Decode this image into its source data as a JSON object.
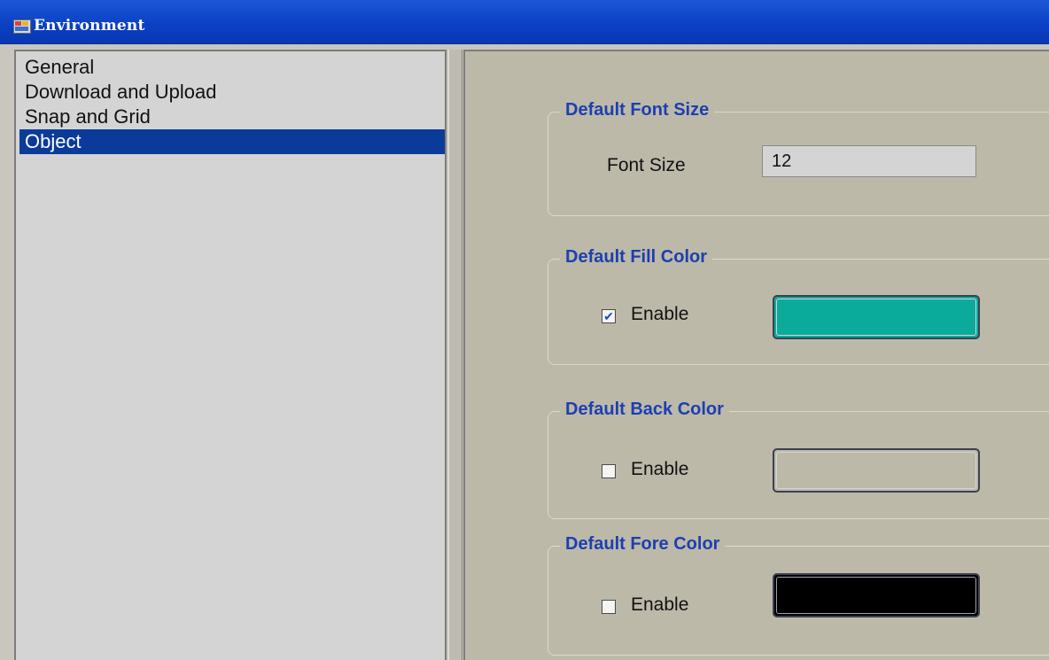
{
  "window": {
    "title": "Environment"
  },
  "tree": {
    "items": [
      {
        "label": "General"
      },
      {
        "label": "Download and Upload"
      },
      {
        "label": "Snap and Grid"
      },
      {
        "label": "Object",
        "selected": true
      }
    ]
  },
  "groups": {
    "font_size": {
      "title": "Default Font Size",
      "label": "Font Size",
      "value": "12"
    },
    "fill_color": {
      "title": "Default Fill Color",
      "enable_label": "Enable",
      "enabled": true,
      "color": "#0aab9a"
    },
    "back_color": {
      "title": "Default Back Color",
      "enable_label": "Enable",
      "enabled": false,
      "color": "#bcb9a9"
    },
    "fore_color": {
      "title": "Default Fore Color",
      "enable_label": "Enable",
      "enabled": false,
      "color": "#000000"
    }
  },
  "colors": {
    "title_bar": "#0a3fc4",
    "selection": "#0b3b9a",
    "group_title": "#1d3fb0",
    "panel_background": "#bcb9a9"
  },
  "icons": {
    "app": "environment-window-icon",
    "check": "checkmark-icon"
  }
}
